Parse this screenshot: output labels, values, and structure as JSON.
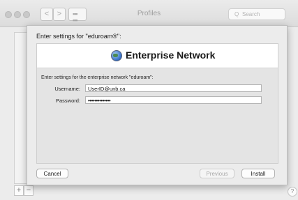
{
  "window": {
    "title": "Profiles",
    "corner_text": "••",
    "nav_back": "<",
    "nav_forward": ">",
    "grid_icon": "grid-icon",
    "search_placeholder": "Search",
    "search_icon": "Q",
    "add_label": "+",
    "remove_label": "−",
    "help_label": "?"
  },
  "sheet": {
    "title": "Enter settings for \"eduroam®\":",
    "header_title": "Enterprise Network",
    "header_icon": "network-globe-icon",
    "description": "Enter settings for the enterprise network \"eduroam\":",
    "username_label": "Username:",
    "username_value": "UserID@unb.ca",
    "password_label": "Password:",
    "password_value": "••••••••••••••",
    "cancel_label": "Cancel",
    "previous_label": "Previous",
    "install_label": "Install"
  }
}
